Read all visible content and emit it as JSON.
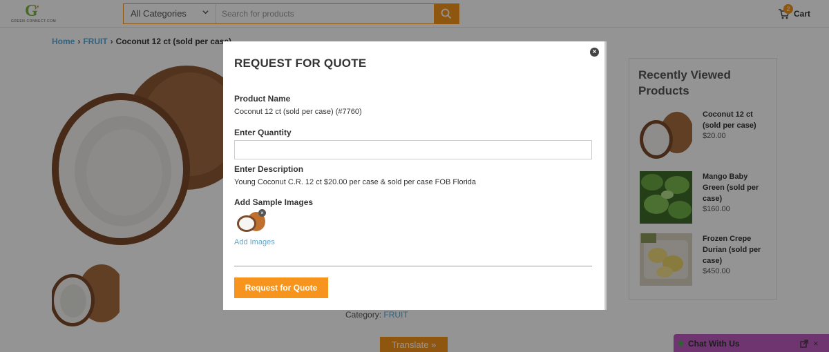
{
  "header": {
    "logo_text": "GREEN-CONNECT.COM",
    "category_select": "All Categories",
    "search_placeholder": "Search for products",
    "cart_count": "2",
    "cart_label": "Cart"
  },
  "breadcrumb": {
    "home": "Home",
    "category": "FRUIT",
    "current": "Coconut 12 ct (sold per case)"
  },
  "product": {
    "category_label": "Category:",
    "category_value": "FRUIT"
  },
  "recently_viewed": {
    "title": "Recently Viewed Products",
    "items": [
      {
        "name": "Coconut 12 ct (sold per case)",
        "price": "$20.00"
      },
      {
        "name": "Mango Baby Green (sold per case)",
        "price": "$160.00"
      },
      {
        "name": "Frozen Crepe Durian (sold per case)",
        "price": "$450.00"
      }
    ]
  },
  "modal": {
    "title": "REQUEST FOR QUOTE",
    "close_label": "×",
    "product_name_label": "Product Name",
    "product_name_value": "Coconut 12 ct (sold per case) (#7760)",
    "quantity_label": "Enter Quantity",
    "quantity_value": "",
    "description_label": "Enter Description",
    "description_value": "Young Coconut C.R. 12 ct $20.00 per case & sold per case FOB Florida",
    "images_label": "Add Sample Images",
    "add_images_link": "Add Images",
    "submit_label": "Request for Quote"
  },
  "translate_label": "Translate »",
  "chat": {
    "label": "Chat With Us",
    "close": "×"
  },
  "colors": {
    "accent": "#f7941d",
    "link": "#5aa9d6",
    "chat": "#bd5cc1",
    "brand_green": "#7cb342"
  }
}
